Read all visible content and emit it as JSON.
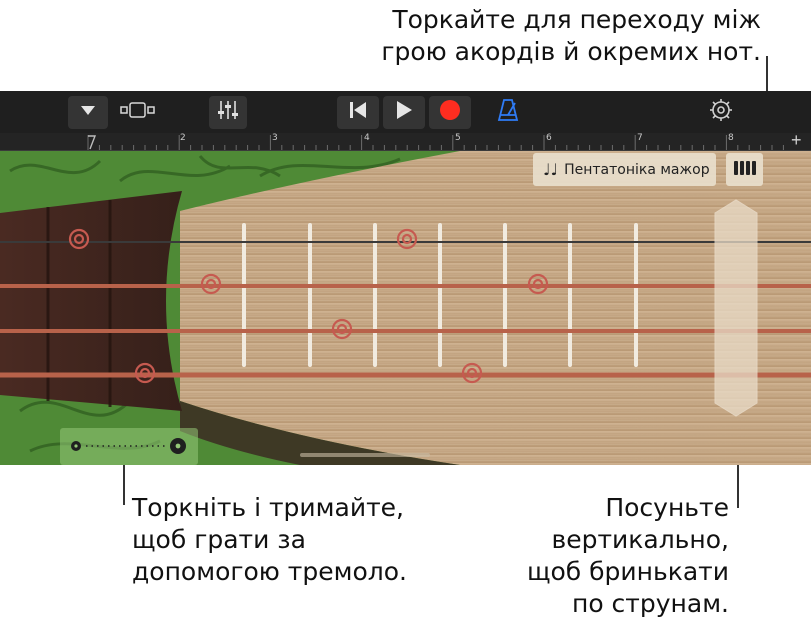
{
  "annotations": {
    "top": [
      "Торкайте для переходу між",
      "грою акордів й окремих нот."
    ],
    "left": [
      "Торкніть і тримайте,",
      "щоб грати за",
      "допомогою тремоло."
    ],
    "right": [
      "Посуньте",
      "вертикально,",
      "щоб бринькати",
      "по струнам."
    ]
  },
  "toolbar": {
    "icons": [
      "caret-down-icon",
      "track-view-icon",
      "mixer-sliders-icon",
      "go-to-start-icon",
      "play-icon",
      "record-icon",
      "metronome-icon",
      "settings-gear-icon"
    ],
    "record_color": "#ff2d20",
    "metronome_color": "#2f7cf6"
  },
  "ruler": {
    "bars": [
      "2",
      "3",
      "4",
      "5",
      "6",
      "7",
      "8"
    ],
    "add_symbol": "+"
  },
  "instrument": {
    "scale_label": "Пентатоніка мажор",
    "note_icon": "♩♩",
    "mode_icon": "notes-mode-icon",
    "tremolo_icon": "tremolo-icon"
  }
}
